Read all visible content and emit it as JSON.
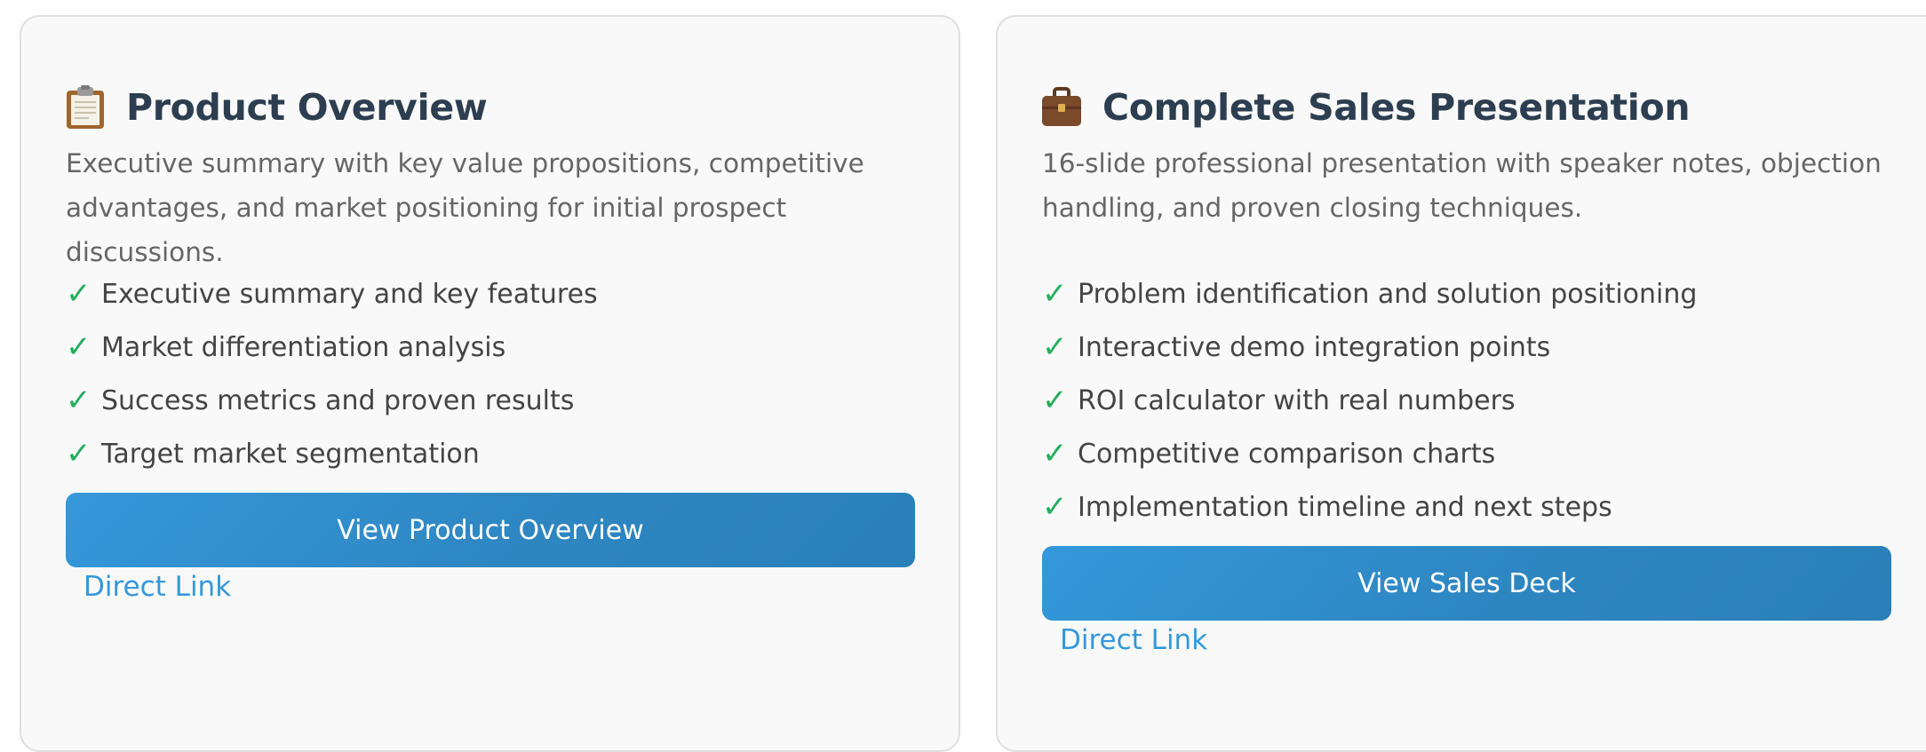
{
  "cards": [
    {
      "icon": "clipboard-icon",
      "title": "Product Overview",
      "description": "Executive summary with key value propositions, competitive advantages, and market positioning for initial prospect discussions.",
      "features": [
        "Executive summary and key features",
        "Market differentiation analysis",
        "Success metrics and proven results",
        "Target market segmentation"
      ],
      "button_label": "View Product Overview",
      "link_label": "Direct Link"
    },
    {
      "icon": "briefcase-icon",
      "title": "Complete Sales Presentation",
      "description": "16-slide professional presentation with speaker notes, objection handling, and proven closing techniques.",
      "features": [
        "Problem identification and solution positioning",
        "Interactive demo integration points",
        "ROI calculator with real numbers",
        "Competitive comparison charts",
        "Implementation timeline and next steps"
      ],
      "button_label": "View Sales Deck",
      "link_label": "Direct Link"
    }
  ],
  "check_glyph": "✓",
  "colors": {
    "title": "#2c3e50",
    "check": "#27ae60",
    "button": "#3498db",
    "link": "#3498db"
  }
}
